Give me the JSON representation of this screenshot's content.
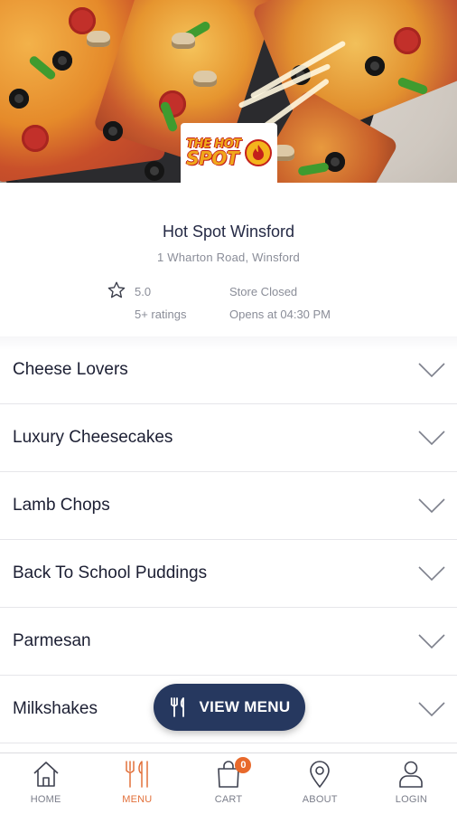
{
  "store": {
    "name": "Hot Spot Winsford",
    "address": "1 Wharton Road, Winsford",
    "rating": "5.0",
    "ratings_count": "5+ ratings",
    "status": "Store Closed",
    "opens": "Opens at 04:30 PM"
  },
  "logo": {
    "top_text": "THE HOT",
    "bottom_text": "SPOT"
  },
  "categories": [
    {
      "label": "Cheese Lovers"
    },
    {
      "label": "Luxury Cheesecakes"
    },
    {
      "label": "Lamb Chops"
    },
    {
      "label": "Back To School Puddings"
    },
    {
      "label": "Parmesan"
    },
    {
      "label": "Milkshakes"
    }
  ],
  "view_menu": {
    "label": "VIEW MENU",
    "icon": "cutlery-icon"
  },
  "nav": {
    "home": {
      "label": "HOME",
      "icon": "home-icon"
    },
    "menu": {
      "label": "MENU",
      "icon": "cutlery-icon"
    },
    "cart": {
      "label": "CART",
      "icon": "shopping-bag-icon",
      "badge": "0"
    },
    "about": {
      "label": "ABOUT",
      "icon": "location-pin-icon"
    },
    "login": {
      "label": "LOGIN",
      "icon": "user-icon"
    }
  },
  "colors": {
    "accent": "#e2703a",
    "primary_dark": "#26385f",
    "text": "#1c1f33",
    "muted": "#8a8d98"
  }
}
